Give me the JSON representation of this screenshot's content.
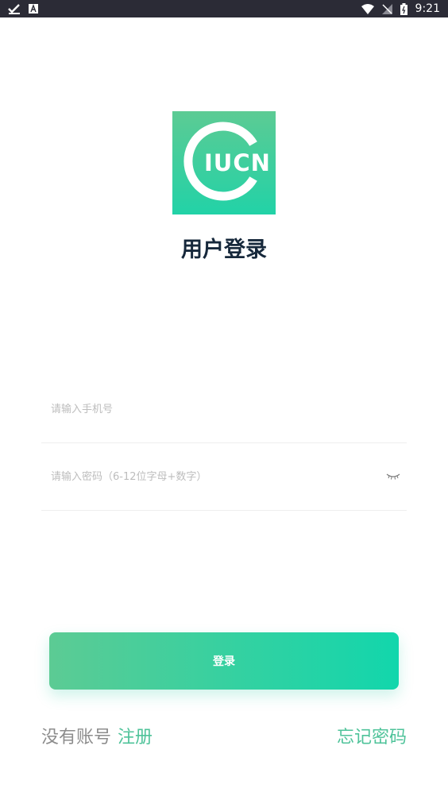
{
  "status_bar": {
    "time": "9:21",
    "icons": [
      "check-icon",
      "a-app-icon",
      "wifi-icon",
      "no-signal-icon",
      "battery-icon"
    ]
  },
  "logo": {
    "text": "IUCN",
    "colors": {
      "top": "#5ccb94",
      "bottom": "#22d2a7"
    }
  },
  "title": "用户登录",
  "form": {
    "phone_placeholder": "请输入手机号",
    "password_placeholder": "请输入密码（6-12位字母+数字）"
  },
  "login_button": "登录",
  "footer": {
    "no_account": "没有账号",
    "register": "注册",
    "forgot_password": "忘记密码"
  },
  "colors": {
    "accent": "#4fc39a",
    "title": "#16283b",
    "status_bar": "#2b2b36"
  }
}
